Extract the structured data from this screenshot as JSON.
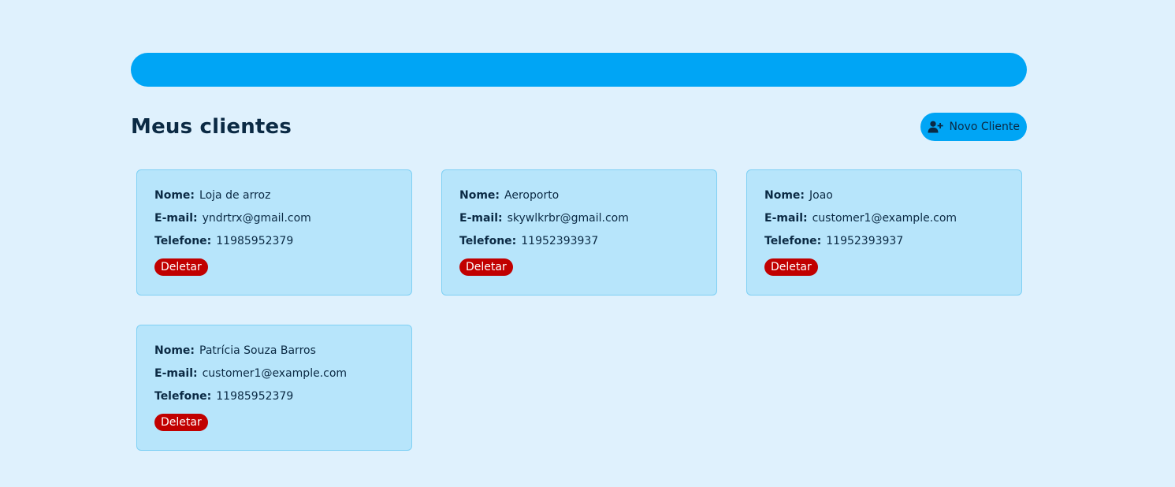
{
  "header": {
    "title": "Meus clientes",
    "new_button_label": "Novo Cliente",
    "new_button_icon": "user-plus-icon"
  },
  "colors": {
    "background": "#dff1fd",
    "accent": "#00a5f5",
    "card_bg": "#b7e5fb",
    "delete": "#c10000",
    "text": "#0b2a44"
  },
  "labels": {
    "name": "Nome:",
    "email": "E-mail:",
    "phone": "Telefone:",
    "delete": "Deletar"
  },
  "clients": [
    {
      "name": "Loja de arroz",
      "email": "yndrtrx@gmail.com",
      "phone": "11985952379"
    },
    {
      "name": "Aeroporto",
      "email": "skywlkrbr@gmail.com",
      "phone": "11952393937"
    },
    {
      "name": "Joao",
      "email": "customer1@example.com",
      "phone": "11952393937"
    },
    {
      "name": "Patrícia Souza Barros",
      "email": "customer1@example.com",
      "phone": "11985952379"
    }
  ]
}
